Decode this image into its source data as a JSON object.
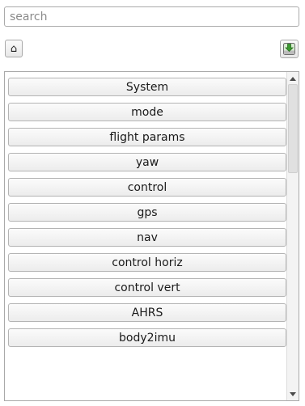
{
  "search": {
    "placeholder": "search",
    "value": ""
  },
  "toolbar": {
    "home_glyph": "⌂",
    "home_icon": "home-icon",
    "download_icon": "download-icon"
  },
  "list": {
    "items": [
      "System",
      "mode",
      "flight params",
      "yaw",
      "control",
      "gps",
      "nav",
      "control horiz",
      "control vert",
      "AHRS",
      "body2imu"
    ]
  }
}
